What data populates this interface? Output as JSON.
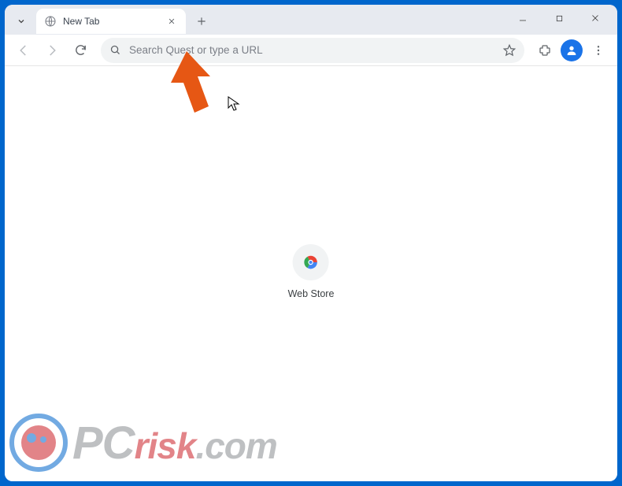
{
  "tab": {
    "title": "New Tab"
  },
  "omnibox": {
    "placeholder": "Search Quest or type a URL",
    "value": ""
  },
  "shortcuts": [
    {
      "label": "Web Store"
    }
  ],
  "watermark": {
    "pc": "PC",
    "risk": "risk",
    "dotcom": ".com"
  }
}
